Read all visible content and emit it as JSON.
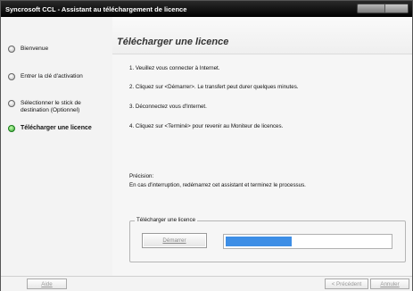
{
  "window": {
    "title": "Syncrosoft CCL - Assistant au téléchargement de licence"
  },
  "sidebar": {
    "items": [
      {
        "label": "Bienvenue",
        "state": "done"
      },
      {
        "label": "Entrer la clé d'activation",
        "state": "done"
      },
      {
        "label": "Sélectionner le stick de destination (Optionnel)",
        "state": "done"
      },
      {
        "label": "Télécharger une licence",
        "state": "active"
      }
    ]
  },
  "main": {
    "title": "Télécharger une licence",
    "steps": [
      "1.  Veuillez vous connecter à Internet.",
      "2.  Cliquez sur <Démarrer>. Le transfert peut durer quelques minutes.",
      "3.  Déconnectez vous d'Internet.",
      "4.  Cliquez sur <Terminé> pour revenir au Moniteur de licences."
    ],
    "note_heading": "Précision:",
    "note_text": "En cas d'interruption, redémarrez cet assistant et terminez le processus."
  },
  "download_group": {
    "label": "Télécharger une licence",
    "start_button": "Démarrer",
    "progress_percent": 40
  },
  "footer": {
    "help_button": "Aide",
    "back_button": "< Précédent",
    "cancel_button": "Annuler"
  },
  "colors": {
    "progress_fill": "#3d8ee6",
    "active_bullet": "#2ca02c",
    "titlebar": "#000000"
  }
}
